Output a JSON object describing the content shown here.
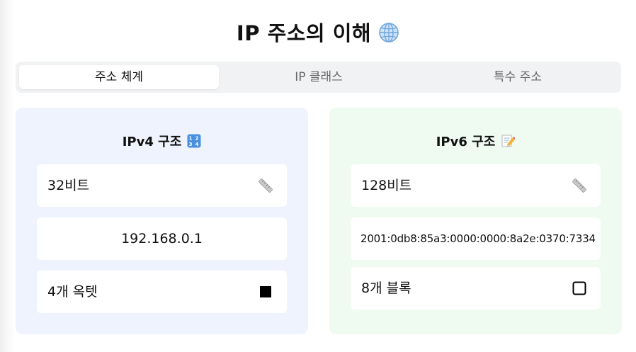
{
  "page": {
    "title": "IP 주소의 이해",
    "title_icon": "globe-icon"
  },
  "tabs": [
    {
      "label": "주소 체계",
      "active": true
    },
    {
      "label": "IP 클래스",
      "active": false
    },
    {
      "label": "특수 주소",
      "active": false
    }
  ],
  "ipv4": {
    "title": "IPv4 구조",
    "title_icon": "numbers-1234-icon",
    "bits": "32비트",
    "bits_icon": "ruler-icon",
    "example": "192.168.0.1",
    "groups": "4개 옥텟",
    "groups_icon": "filled-square-icon"
  },
  "ipv6": {
    "title": "IPv6 구조",
    "title_icon": "memo-icon",
    "bits": "128비트",
    "bits_icon": "ruler-icon",
    "example": "2001:0db8:85a3:0000:0000:8a2e:0370:7334",
    "groups": "8개 블록",
    "groups_icon": "empty-square-icon"
  },
  "colors": {
    "ipv4_card_bg": "#eef3fd",
    "ipv6_card_bg": "#effaf1",
    "tab_bar_bg": "#f1f2f4"
  }
}
